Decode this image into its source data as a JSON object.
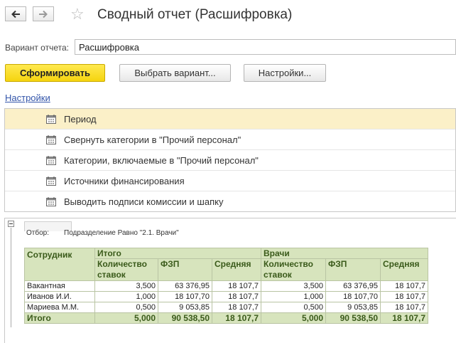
{
  "header": {
    "title": "Сводный отчет (Расшифровка)",
    "back_icon": "arrow-left-icon",
    "forward_icon": "arrow-right-icon",
    "favorite_icon": "star-icon"
  },
  "variant": {
    "label": "Вариант отчета:",
    "value": "Расшифровка"
  },
  "toolbar": {
    "generate_label": "Сформировать",
    "choose_variant_label": "Выбрать вариант...",
    "settings_label": "Настройки..."
  },
  "settings_link": "Настройки",
  "settings_items": [
    {
      "label": "Период",
      "selected": true
    },
    {
      "label": "Свернуть категории в \"Прочий персонал\"",
      "selected": false
    },
    {
      "label": "Категории, включаемые в \"Прочий персонал\"",
      "selected": false
    },
    {
      "label": "Источники финансирования",
      "selected": false
    },
    {
      "label": "Выводить подписи комиссии и шапку",
      "selected": false
    }
  ],
  "report": {
    "filter_label": "Отбор:",
    "filter_value": "Подразделение Равно \"2.1. Врачи\"",
    "col_employee": "Сотрудник",
    "group_total": "Итого",
    "group_doctors": "Врачи",
    "col_rates": "Количество ставок",
    "col_fzp": "ФЗП",
    "col_avg": "Средняя",
    "rows": [
      {
        "name": "Вакантная",
        "t_rates": "3,500",
        "t_fzp": "63 376,95",
        "t_avg": "18 107,7",
        "d_rates": "3,500",
        "d_fzp": "63 376,95",
        "d_avg": "18 107,7"
      },
      {
        "name": "Иванов И.И.",
        "t_rates": "1,000",
        "t_fzp": "18 107,70",
        "t_avg": "18 107,7",
        "d_rates": "1,000",
        "d_fzp": "18 107,70",
        "d_avg": "18 107,7"
      },
      {
        "name": "Мариева М.М.",
        "t_rates": "0,500",
        "t_fzp": "9 053,85",
        "t_avg": "18 107,7",
        "d_rates": "0,500",
        "d_fzp": "9 053,85",
        "d_avg": "18 107,7"
      }
    ],
    "total": {
      "name": "Итого",
      "t_rates": "5,000",
      "t_fzp": "90 538,50",
      "t_avg": "18 107,7",
      "d_rates": "5,000",
      "d_fzp": "90 538,50",
      "d_avg": "18 107,7"
    }
  },
  "colors": {
    "primary_button": "#f5d40f",
    "selected_row": "#fbf0c8",
    "table_header": "#d7e4bd",
    "link": "#3355aa"
  }
}
